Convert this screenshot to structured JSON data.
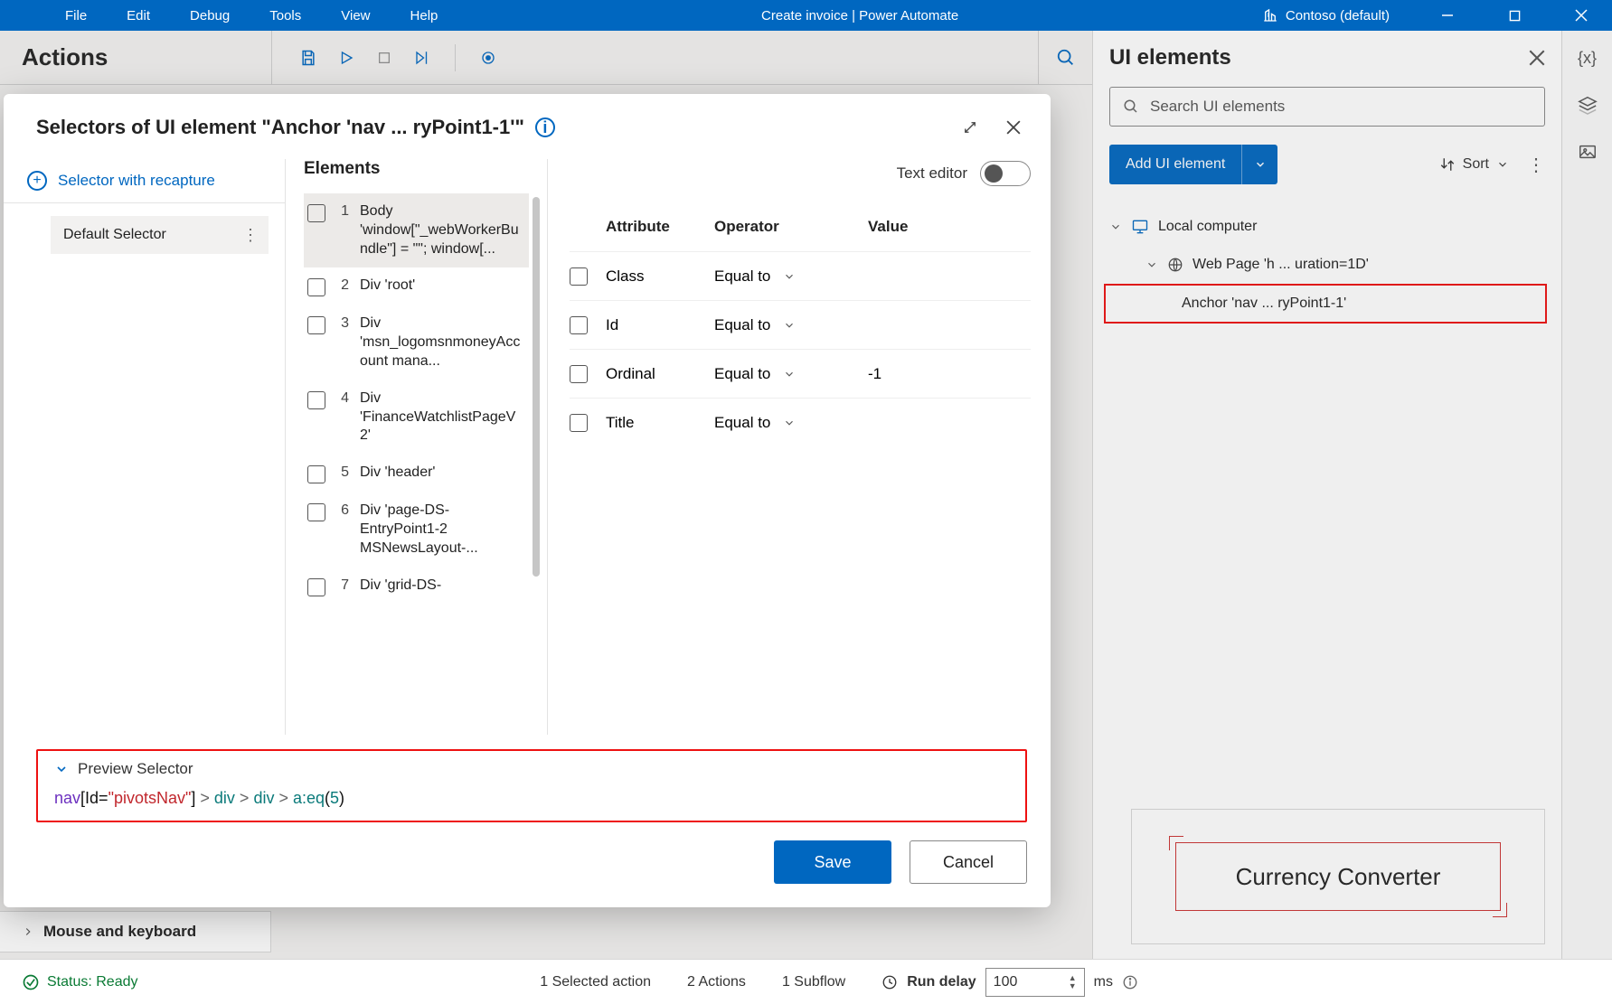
{
  "titlebar": {
    "menu": [
      "File",
      "Edit",
      "Debug",
      "Tools",
      "View",
      "Help"
    ],
    "center": "Create invoice | Power Automate",
    "org": "Contoso (default)"
  },
  "actions_title": "Actions",
  "search_placeholder": "Search UI elements",
  "ui_panel": {
    "title": "UI elements",
    "add_label": "Add UI element",
    "sort_label": "Sort",
    "tree": {
      "root": "Local computer",
      "page": "Web Page 'h ... uration=1D'",
      "item": "Anchor 'nav ... ryPoint1-1'"
    },
    "thumb_label": "Currency Converter"
  },
  "mk_label": "Mouse and keyboard",
  "status": {
    "ready": "Status: Ready",
    "selected": "1 Selected action",
    "actions": "2 Actions",
    "subflow": "1 Subflow",
    "delay_label": "Run delay",
    "delay_value": "100",
    "ms": "ms"
  },
  "dialog": {
    "title": "Selectors of UI element \"Anchor 'nav ... ryPoint1-1'\"",
    "recapture": "Selector with recapture",
    "default_selector": "Default Selector",
    "elements_label": "Elements",
    "text_editor": "Text editor",
    "elements": [
      {
        "n": "1",
        "t": "Body 'window[\"_webWorkerBundle\"] = \"\"; window[..."
      },
      {
        "n": "2",
        "t": "Div 'root'"
      },
      {
        "n": "3",
        "t": "Div 'msn_logomsnmoneyAccount mana..."
      },
      {
        "n": "4",
        "t": "Div 'FinanceWatchlistPageV2'"
      },
      {
        "n": "5",
        "t": "Div 'header'"
      },
      {
        "n": "6",
        "t": "Div 'page-DS-EntryPoint1-2 MSNewsLayout-..."
      },
      {
        "n": "7",
        "t": "Div 'grid-DS-"
      }
    ],
    "attr_header": {
      "a": "Attribute",
      "o": "Operator",
      "v": "Value"
    },
    "rows": [
      {
        "a": "Class",
        "o": "Equal to",
        "v": ""
      },
      {
        "a": "Id",
        "o": "Equal to",
        "v": ""
      },
      {
        "a": "Ordinal",
        "o": "Equal to",
        "v": "-1"
      },
      {
        "a": "Title",
        "o": "Equal to",
        "v": ""
      }
    ],
    "preview_label": "Preview Selector",
    "selector": {
      "p1": "nav",
      "p2": "[Id=",
      "p3": "\"pivotsNav\"",
      "p4": "]",
      " gt": " > ",
      "p5": "div",
      "p6": "div",
      "p7": "a:eq",
      "p8": "(",
      "p9": "5",
      "p10": ")"
    },
    "save": "Save",
    "cancel": "Cancel"
  }
}
